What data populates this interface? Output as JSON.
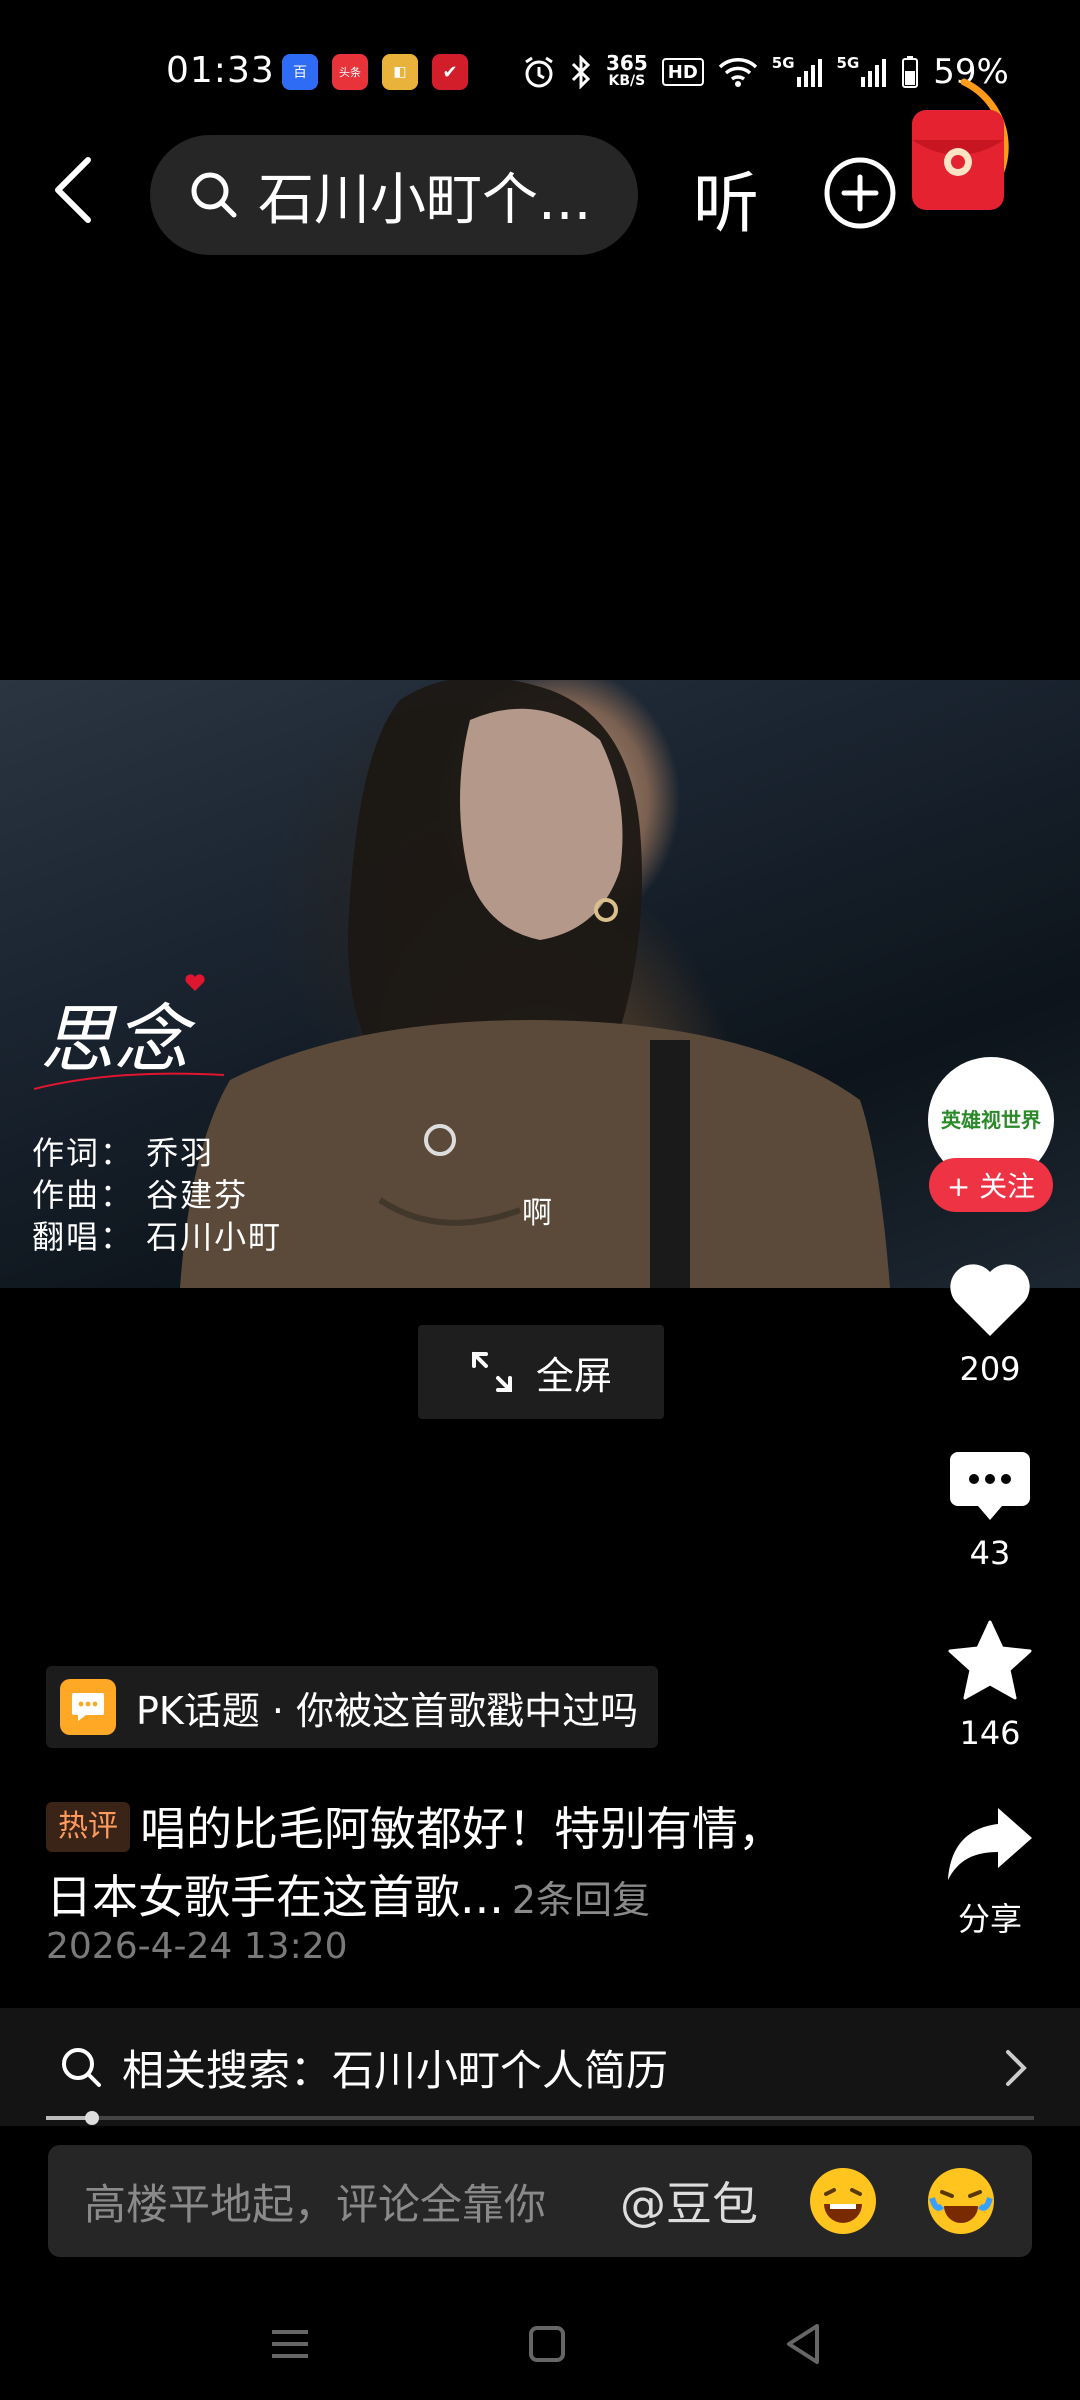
{
  "status_bar": {
    "time": "01:33",
    "app_icons": [
      {
        "name": "baidu-app-icon",
        "color": "#2f6cf5",
        "glyph": "百"
      },
      {
        "name": "toutiao-app-icon",
        "color": "#e8333a",
        "glyph": "头条"
      },
      {
        "name": "app3-icon",
        "color": "#e9b23a",
        "glyph": "◧"
      },
      {
        "name": "app4-icon",
        "color": "#d21e2b",
        "glyph": "✔"
      }
    ],
    "speed_value": "365",
    "speed_unit": "KB/S",
    "hd_label": "HD",
    "signal_label": "5G",
    "battery": "59%"
  },
  "top_bar": {
    "search_text": "石川小町个...",
    "listen_label": "听"
  },
  "video": {
    "song_title": "思念",
    "lyricist": "作词：  乔羽",
    "composer": "作曲：  谷建芬",
    "singer": "翻唱：  石川小町",
    "subtitle": "啊"
  },
  "fullscreen_label": "全屏",
  "author": {
    "avatar_text": "英雄视世界",
    "follow_label": "+ 关注"
  },
  "actions": {
    "likes": "209",
    "comments": "43",
    "favorites": "146",
    "share_label": "分享"
  },
  "pk_topic": "PK话题 · 你被这首歌戳中过吗",
  "hot_comment": {
    "badge": "热评",
    "text": "唱的比毛阿敏都好！特别有情，日本女歌手在这首歌...",
    "replies": "2条回复",
    "time": "2026-4-24 13:20"
  },
  "related_search": "相关搜索：石川小町个人简历",
  "playback_progress": 0.047,
  "comment_box": {
    "placeholder": "高楼平地起，评论全靠你",
    "mention": "@豆包"
  },
  "colors": {
    "accent_red": "#ee3344",
    "pk_orange": "#ffa826",
    "hot_orange": "#ff9a5c"
  }
}
